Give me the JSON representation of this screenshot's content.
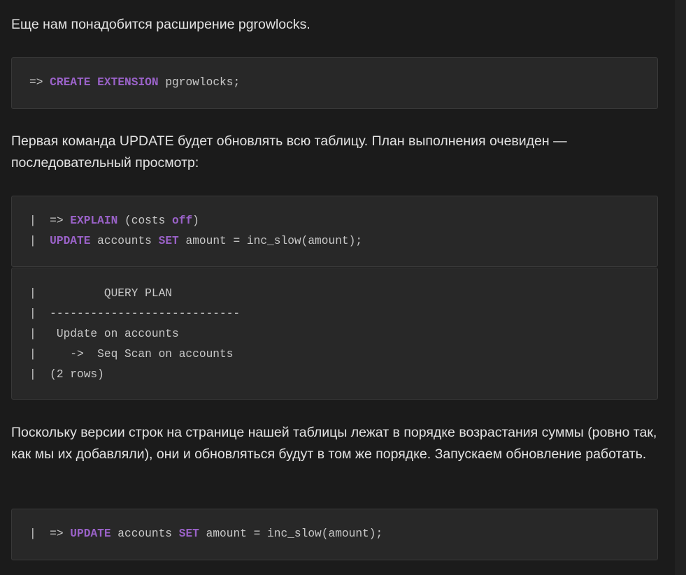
{
  "paragraphs": {
    "p1": "Еще нам понадобится расширение pgrowlocks.",
    "p2": "Первая команда UPDATE будет обновлять всю таблицу. План выполнения очевиден — последовательный просмотр:",
    "p3": "Поскольку версии строк на странице нашей таблицы лежат в порядке возрастания суммы (ровно так, как мы их добавляли), они и обновляться будут в том же порядке. Запускаем обновление работать."
  },
  "code_create_extension": {
    "prompt": "=> ",
    "kw1": "CREATE",
    "kw2": "EXTENSION",
    "rest": " pgrowlocks;"
  },
  "code_explain": {
    "line1": {
      "prefix": "|  => ",
      "kw1": "EXPLAIN",
      "mid": " (costs ",
      "kw2": "off",
      "end": ")"
    },
    "line2": {
      "prefix": "|  ",
      "kw1": "UPDATE",
      "mid": " accounts ",
      "kw2": "SET",
      "end": " amount = inc_slow(amount);"
    }
  },
  "code_query_plan": {
    "lines": [
      "|          QUERY PLAN",
      "|  ----------------------------",
      "|   Update on accounts",
      "|     ->  Seq Scan on accounts",
      "|  (2 rows)"
    ]
  },
  "code_update": {
    "prefix": "|  => ",
    "kw1": "UPDATE",
    "mid": " accounts ",
    "kw2": "SET",
    "end": " amount = inc_slow(amount);"
  },
  "colors": {
    "background": "#1b1b1b",
    "code_background": "#282828",
    "keyword": "#9a62c8",
    "text": "#e3e3e3",
    "code_text": "#c9c9c9"
  }
}
